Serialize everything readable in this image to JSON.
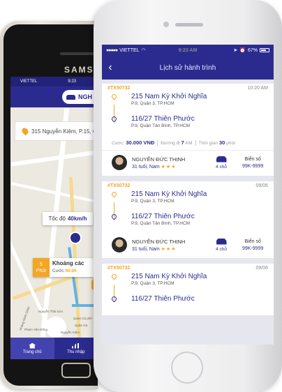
{
  "android": {
    "brand": "SAMSUNG",
    "status": {
      "carrier": "VIETTEL",
      "time": "9:23"
    },
    "header": {
      "pill_label": "NGH"
    },
    "address": "315 Nguyễn Kiệm, P.15, G",
    "speed": {
      "label": "Tốc độ",
      "value": "40km/h"
    },
    "eta": {
      "minutes": "5",
      "unit": "Phút",
      "distance_label": "Khoảng các",
      "fee_label": "Cước",
      "fee_value": "50.00"
    },
    "map_labels": [
      "Nguyễn Thái Sơn",
      "Phạm Văn Đồng",
      "Hoàng Minh Giám",
      "Nguyễn Kiệm",
      "Quán Cà phê",
      "Quán Gà"
    ],
    "tabs": [
      {
        "label": "Trang chủ",
        "icon": "home-icon"
      },
      {
        "label": "Thu nhập",
        "icon": "chart-icon"
      }
    ]
  },
  "ios": {
    "status": {
      "carrier": "VIETTEL",
      "time": "9:23 AM",
      "battery": "67%"
    },
    "nav": {
      "title": "Lịch sử hành trình"
    },
    "trips": [
      {
        "code": "#TX50732",
        "time": "10:20 AM",
        "from": {
          "name": "215 Nam Kỳ Khởi Nghĩa",
          "detail": "P.9, Quận 3, TP.HCM"
        },
        "to": {
          "name": "116/27 Thiên Phước",
          "detail": "P.9, Quận Tân Bình, TP.HCM"
        },
        "fare_label": "Cước:",
        "fare": "30.000 VNĐ",
        "distance_label": "Đường đi",
        "distance": "7",
        "distance_unit": "KM",
        "duration_label": "Thời gian",
        "duration": "30",
        "duration_unit": "phút",
        "driver": {
          "name": "NGUYỄN ĐỨC THỊNH",
          "info": "31 tuổi, Nam",
          "stars": "★★★"
        },
        "seats": "4 chỗ",
        "plate_label": "Biển số",
        "plate": "99K-9999"
      },
      {
        "code": "#TX50732",
        "time": "09/06",
        "from": {
          "name": "215 Nam Kỳ Khởi Nghĩa",
          "detail": "P.9, Quận 3, TP.HCM"
        },
        "to": {
          "name": "116/27 Thiên Phước",
          "detail": "P.9, Quận Tân Bình, TP.HCM"
        },
        "driver": {
          "name": "NGUYỄN ĐỨC THỊNH",
          "info": "31 tuổi, Nam",
          "stars": "★★★"
        },
        "seats": "4 chỗ",
        "plate_label": "Biển số",
        "plate": "99K-9999"
      },
      {
        "code": "#TX50732",
        "time": "09/06",
        "from": {
          "name": "215 Nam Kỳ Khởi Nghĩa",
          "detail": "P.9, Quận 3, TP.HCM"
        },
        "to": {
          "name": "116/27 Thiên Phước",
          "detail": ""
        }
      }
    ]
  },
  "colors": {
    "brand": "#2b2b8f",
    "accent": "#f2a623"
  }
}
